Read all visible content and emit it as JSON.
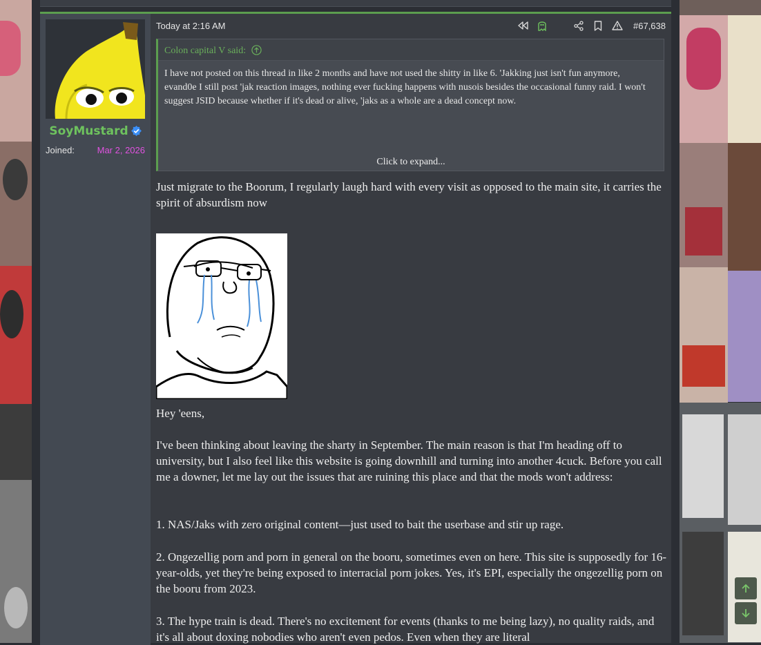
{
  "post": {
    "date": "Today at 2:16 AM",
    "number": "#67,638",
    "author": {
      "username": "SoyMustard",
      "joined_label": "Joined:",
      "joined_date": "Mar 2, 2026"
    },
    "quote": {
      "author_line": "Colon capital V said:",
      "text": "I have not posted on this thread in like 2 months and have not used the shitty in like 6. 'Jakking just isn't fun anymore, evand0e I still post 'jak reaction images, nothing ever fucking happens with nusois besides the occasional funny raid. I won't suggest JSID because whether if it's dead or alive, 'jaks as a whole are a dead concept now.",
      "expand_label": "Click to expand..."
    },
    "paragraphs": [
      "Just migrate to the Boorum, I regularly laugh hard with every visit as opposed to the main site, it carries the spirit of absurdism now",
      "Hey 'eens,",
      "I've been thinking about leaving the sharty in September. The main reason is that I'm heading off to university, but I also feel like this website is going downhill and turning into another 4cuck. Before you call me a downer, let me lay out the issues that are ruining this place and that the mods won't address:",
      "1. NAS/Jaks with zero original content—just used to bait the userbase and stir up rage.",
      "2. Ongezellig porn and porn in general on the booru, sometimes even on here. This site is supposedly for 16-year-olds, yet they're being exposed to interracial porn jokes. Yes, it's EPI, especially the ongezellig porn on the booru from 2023.",
      "3. The hype train is dead. There's no excitement for events (thanks to me being lazy), no quality raids, and it's all about doxing nobodies who aren't even pedos. Even when they are literal"
    ],
    "icons": [
      "rewind-icon",
      "ghost-icon",
      "share-icon",
      "bookmark-icon",
      "warning-icon",
      "verified-badge-icon",
      "arrow-up-circle-icon"
    ]
  },
  "colors": {
    "accent_green": "#6ec25e",
    "joined_date": "#e052e0",
    "post_bg": "#383b41",
    "user_cell_bg": "#434952"
  }
}
